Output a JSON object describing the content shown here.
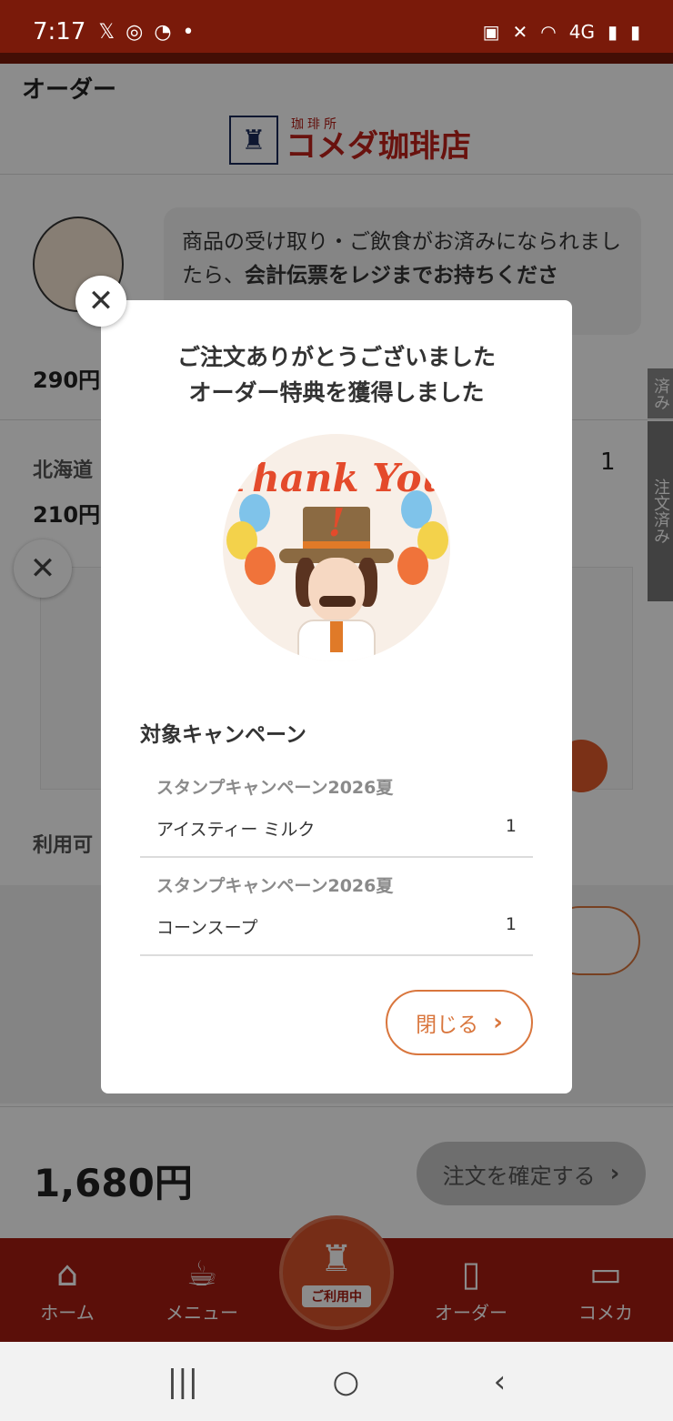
{
  "status_bar": {
    "time": "7:17",
    "left_icons": [
      "x-icon",
      "instagram-icon",
      "wifi-question-icon",
      "dot-icon"
    ],
    "network_label": "4G"
  },
  "header": {
    "title": "オーダー",
    "logo_sub": "珈琲所",
    "logo_main": "コメダ珈琲店"
  },
  "background": {
    "chat_text_plain": "商品の受け取り・ご飲食がお済みになられましたら、",
    "chat_text_bold": "会計伝票をレジまでお持ちくださ",
    "item1_price": "290円",
    "item2_name": "北海道",
    "item2_price": "210円",
    "item2_qty": "1",
    "side_tab1": "済み",
    "side_tab2": "注文済み",
    "available_label": "利用可"
  },
  "footer": {
    "total": "1,680円",
    "confirm_label": "注文を確定する"
  },
  "bottom_nav": {
    "items": [
      {
        "label": "ホーム",
        "icon": "home-icon"
      },
      {
        "label": "メニュー",
        "icon": "coffee-cup-icon"
      },
      {
        "label": "オーダー",
        "icon": "phone-icon"
      },
      {
        "label": "コメカ",
        "icon": "card-icon"
      }
    ],
    "center_label": "ご利用中"
  },
  "modal": {
    "title_line1": "ご注文ありがとうございました",
    "title_line2": "オーダー特典を獲得しました",
    "image_text": "Thank You !",
    "campaign_heading": "対象キャンペーン",
    "campaigns": [
      {
        "name": "スタンプキャンペーン2026夏",
        "item": "アイスティー ミルク",
        "qty": "1"
      },
      {
        "name": "スタンプキャンペーン2026夏",
        "item": "コーンスープ",
        "qty": "1"
      }
    ],
    "close_label": "閉じる"
  },
  "colors": {
    "brand_red": "#a61d11",
    "accent_orange": "#d9763d"
  }
}
